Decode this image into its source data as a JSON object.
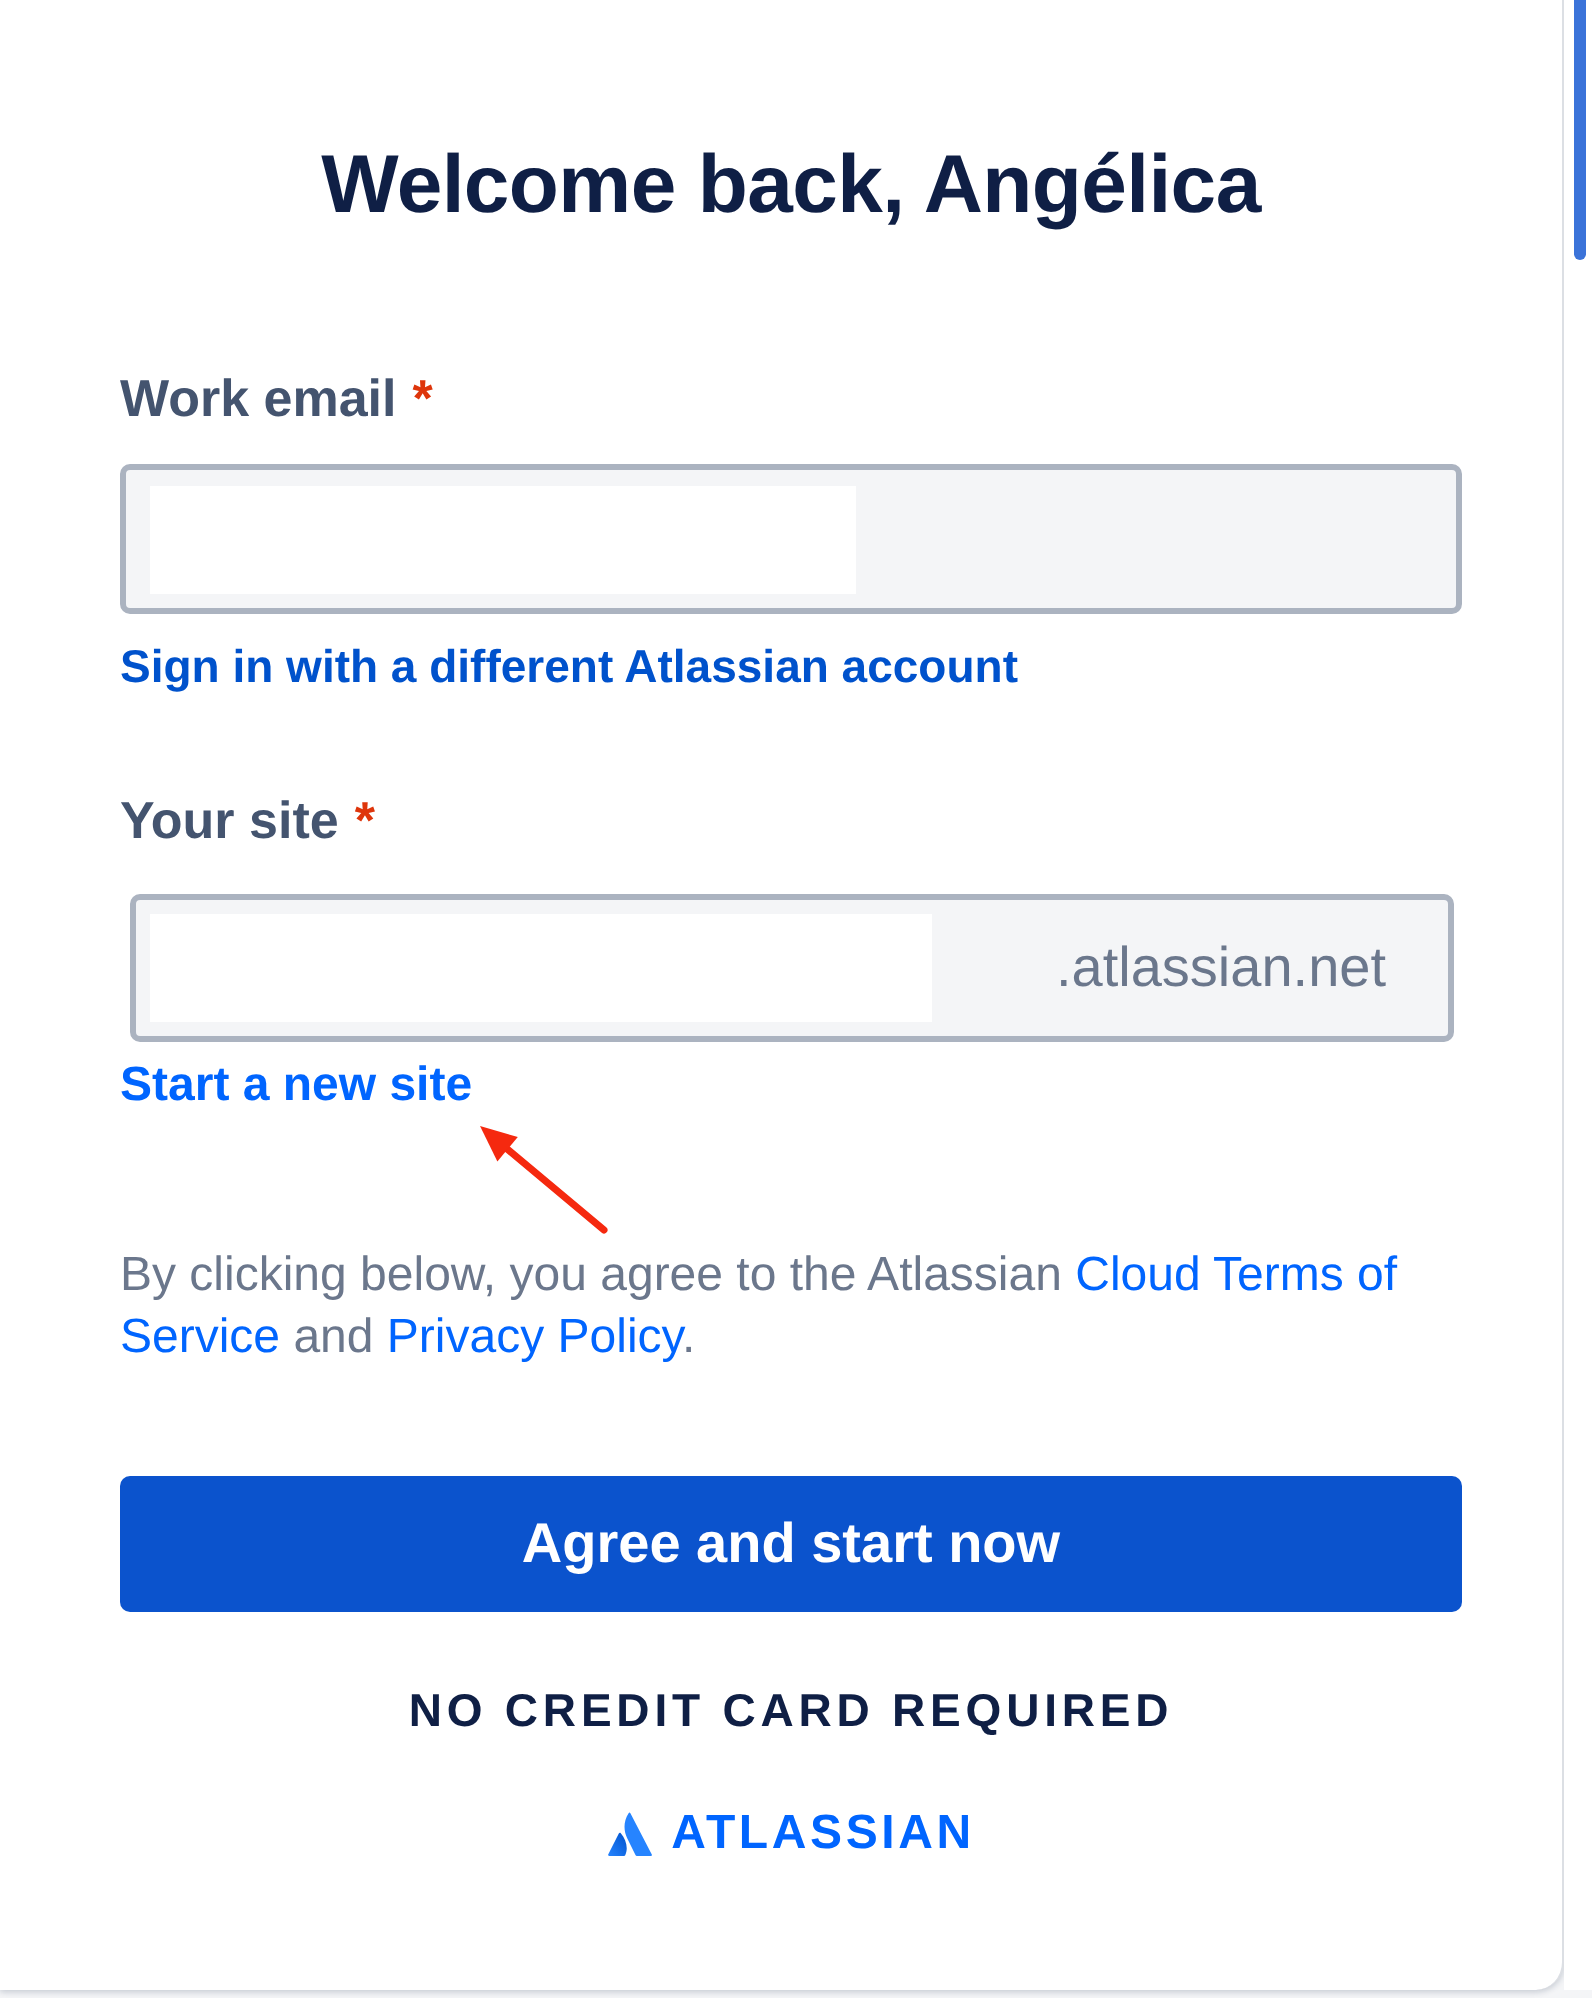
{
  "title": "Welcome back, Angélica",
  "email_field": {
    "label": "Work email",
    "required_mark": "*",
    "redacted": true
  },
  "switch_account_link": "Sign in with a different Atlassian account",
  "site_field": {
    "label": "Your site",
    "required_mark": "*",
    "redacted": true,
    "suffix": ".atlassian.net"
  },
  "new_site_link": "Start a new site",
  "terms": {
    "lines": [
      [
        {
          "kind": "text",
          "text": "By clicking below, you agree to the Atlassian "
        },
        {
          "kind": "link",
          "text": "Cloud Terms of"
        }
      ],
      [
        {
          "kind": "link",
          "text": "Service"
        },
        {
          "kind": "text",
          "text": " and "
        },
        {
          "kind": "link",
          "text": "Privacy Policy"
        },
        {
          "kind": "text",
          "text": "."
        }
      ]
    ]
  },
  "submit_button": "Agree and start now",
  "note": "NO CREDIT CARD REQUIRED",
  "logo": {
    "wordmark": "ATLASSIAN"
  }
}
